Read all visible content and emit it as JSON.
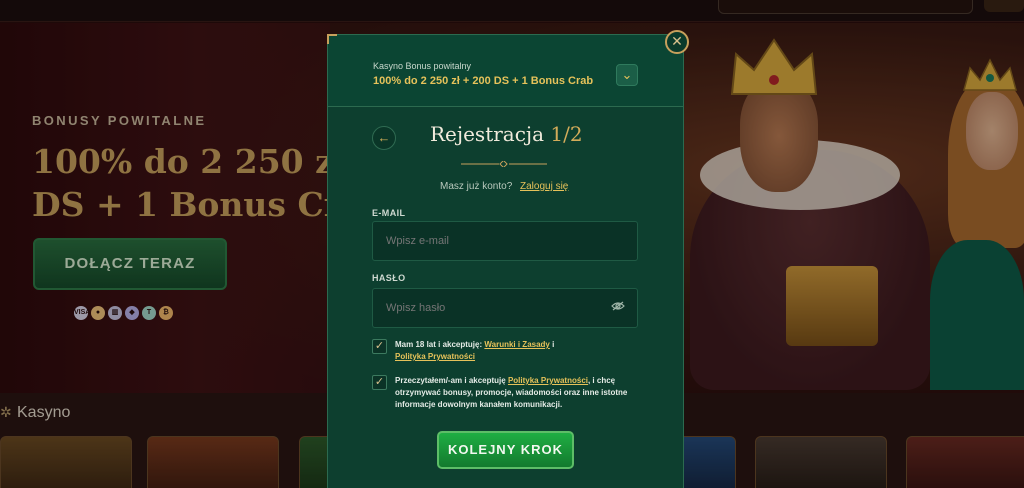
{
  "topbar": {
    "search_placeholder": ""
  },
  "hero": {
    "welcome_label": "BONUSY POWITALNE",
    "title_line1": "100% do 2 250 zł + 200",
    "title_line2": "DS + 1 Bonus Crab",
    "join_button": "DOŁĄCZ TERAZ",
    "payments": [
      {
        "icon": "visa-icon",
        "text": "VISA",
        "color": "#d9d4e8"
      },
      {
        "icon": "mastercard-icon",
        "text": "",
        "color": "#f0c27a"
      },
      {
        "icon": "bank-icon",
        "text": "",
        "color": "#c7c2e0"
      },
      {
        "icon": "ethereum-icon",
        "text": "",
        "color": "#b7b0e8"
      },
      {
        "icon": "tether-icon",
        "text": "",
        "color": "#a3d7c8"
      },
      {
        "icon": "bitcoin-icon",
        "text": "",
        "color": "#f2b86a"
      }
    ]
  },
  "section": {
    "casino_label": "Kasyno"
  },
  "modal": {
    "bonus_label": "Kasyno Bonus powitalny",
    "bonus_text": "100% do 2 250 zł + 200 DS + 1 Bonus Crab",
    "title": "Rejestracja",
    "step": "1/2",
    "have_account": "Masz już konto?",
    "login_link": "Zaloguj się",
    "email_label": "E-MAIL",
    "email_placeholder": "Wpisz e-mail",
    "password_label": "HASŁO",
    "password_placeholder": "Wpisz hasło",
    "terms_part1": "Mam 18 lat i akceptuję: ",
    "terms_link": "Warunki i Zasady",
    "terms_part2": " i ",
    "terms_privacy": "Polityka Prywatności",
    "marketing_part1": "Przeczytałem/-am i akceptuję ",
    "marketing_link": "Polityka Prywatności",
    "marketing_part2": ", i chcę otrzymywać bonusy, promocje, wiadomości oraz inne istotne informacje dowolnym kanałem komunikacji.",
    "next_button": "KOLEJNY KROK"
  },
  "colors": {
    "accent_gold": "#e6c25a",
    "modal_green": "#0d3f2f",
    "button_green": "#1fae43"
  }
}
